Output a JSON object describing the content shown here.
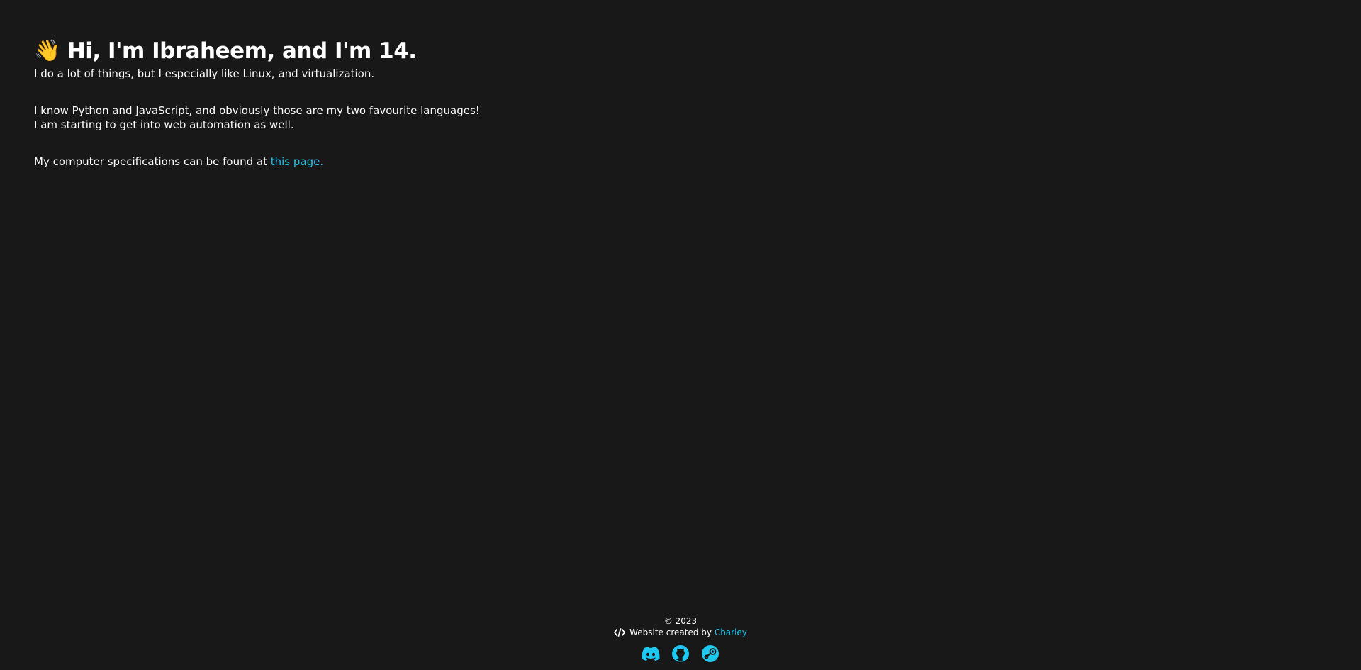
{
  "header": {
    "wave_icon": "waving-hand-icon",
    "title": "Hi, I'm Ibraheem, and I'm 14."
  },
  "intro": {
    "line1": "I do a lot of things, but I especially like Linux, and virtualization.",
    "languages_line1": "I know Python and JavaScript, and obviously those are my two favourite languages!",
    "languages_line2": "I am starting to get into web automation as well.",
    "specs_prefix": "My computer specifications can be found at ",
    "specs_link": "this page."
  },
  "footer": {
    "copyright": "© 2023",
    "credit_prefix": "Website created by ",
    "credit_name": "Charley",
    "socials": [
      "discord-icon",
      "github-icon",
      "steam-icon"
    ]
  },
  "colors": {
    "background": "#181818",
    "text": "#ffffff",
    "accent": "#1ec8f0"
  }
}
